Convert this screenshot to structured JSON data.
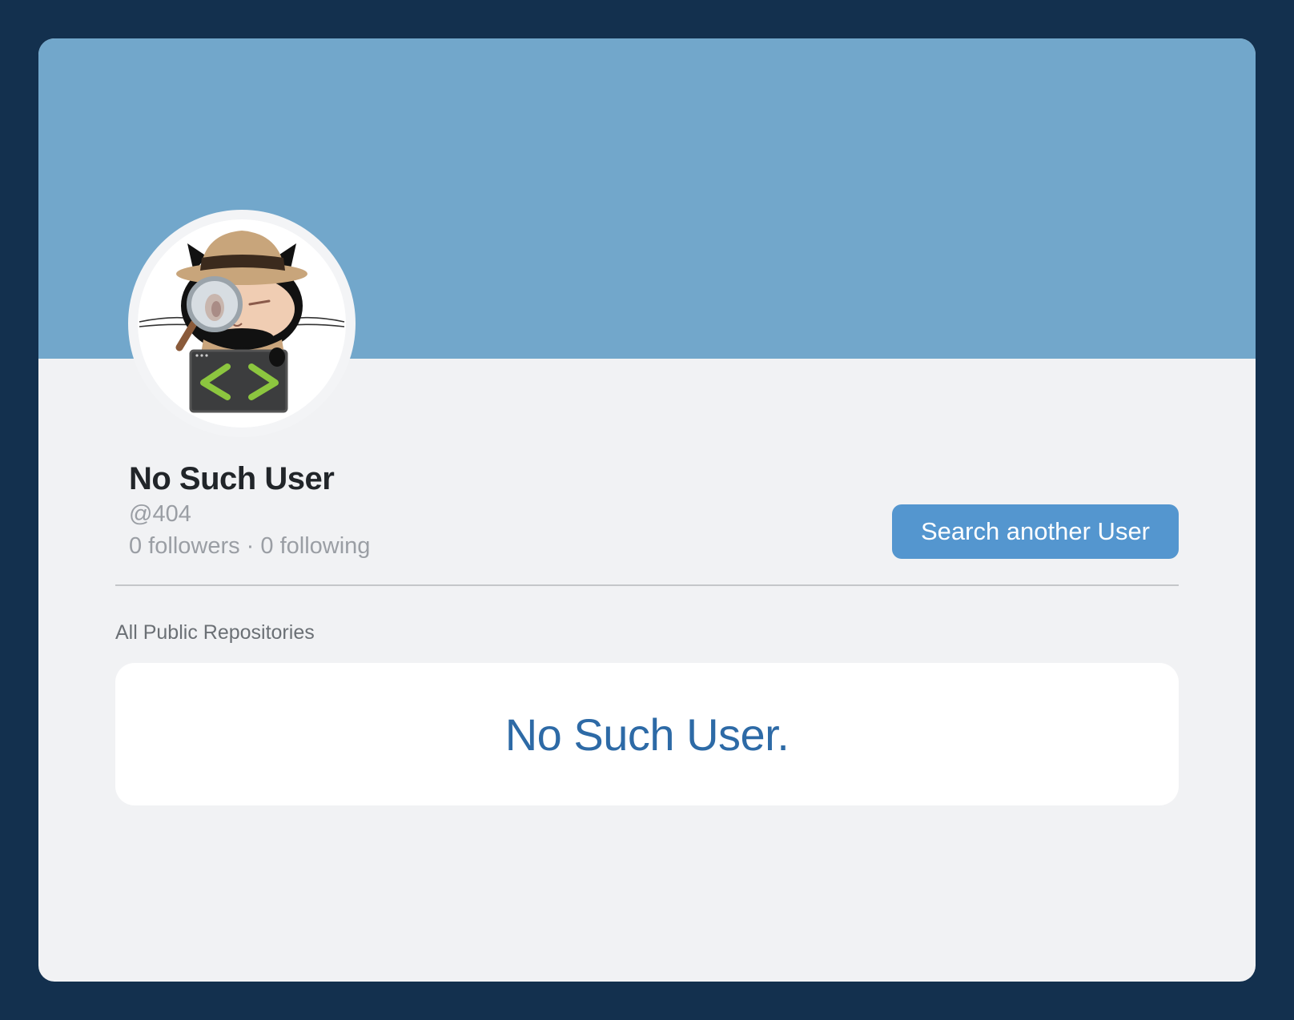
{
  "profile": {
    "name": "No Such User",
    "handle": "@404",
    "stats": "0 followers · 0 following"
  },
  "actions": {
    "search_label": "Search another User"
  },
  "repositories": {
    "section_label": "All Public Repositories",
    "empty_message": "No Such User."
  },
  "colors": {
    "page_background": "#13304e",
    "banner": "#72a7cb",
    "card": "#f1f2f4",
    "button": "#5496cf",
    "empty_message": "#2d6aa6"
  },
  "icons": {
    "avatar": "detective-octocat-icon"
  }
}
